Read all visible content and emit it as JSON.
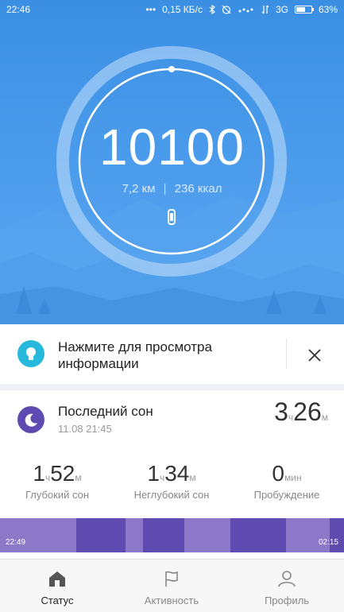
{
  "status_bar": {
    "time": "22:46",
    "network_speed": "0,15 КБ/с",
    "network_type": "3G",
    "battery_percent": "63%",
    "battery_level": 0.63,
    "dots_icon": "more-dots-icon",
    "bluetooth_icon": "bluetooth-icon",
    "alarm_icon": "alarm-off-icon",
    "signal_icon": "signal-icon"
  },
  "activity": {
    "steps": "10100",
    "distance_value": "7,2",
    "distance_unit": "км",
    "calories_value": "236",
    "calories_unit": "ккал",
    "goal_progress": 1.0,
    "ring_icon": "step-ring",
    "band_icon": "fitness-band-icon"
  },
  "tip": {
    "text_line1": "Нажмите для просмотра",
    "text_line2": "информации",
    "icon": "lightbulb-icon",
    "close_icon": "close-icon"
  },
  "sleep": {
    "title": "Последний сон",
    "date": "11.08 21:45",
    "icon": "moon-icon",
    "total_hours": "3",
    "total_hours_unit": "ч",
    "total_minutes": "26",
    "total_minutes_unit": "м",
    "deep": {
      "hours": "1",
      "hours_unit": "ч",
      "minutes": "52",
      "minutes_unit": "м",
      "label": "Глубокий сон"
    },
    "light": {
      "hours": "1",
      "hours_unit": "ч",
      "minutes": "34",
      "minutes_unit": "м",
      "label": "Неглубокий сон"
    },
    "awake": {
      "value": "0",
      "unit": "мин",
      "label": "Пробуждение"
    },
    "timeline_start": "22:49",
    "timeline_end": "02:15",
    "timeline_colors": {
      "deep": "#5e4bb0",
      "light": "#8b78c9"
    }
  },
  "nav": {
    "items": [
      {
        "label": "Статус",
        "icon": "home-icon",
        "active": true
      },
      {
        "label": "Активность",
        "icon": "flag-icon",
        "active": false
      },
      {
        "label": "Профиль",
        "icon": "person-icon",
        "active": false
      }
    ]
  },
  "colors": {
    "hero_blue": "#3f93e6",
    "tip_icon": "#27b9dc",
    "sleep_icon": "#5e4bb2"
  }
}
